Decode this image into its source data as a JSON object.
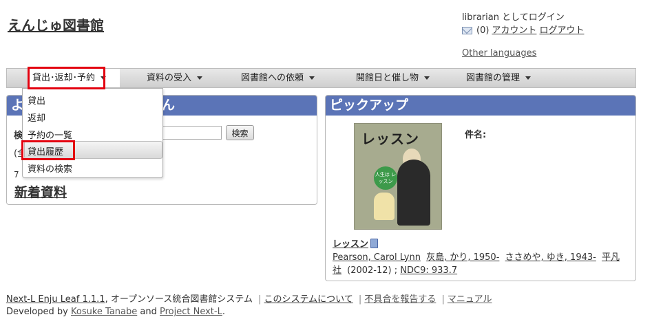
{
  "header": {
    "site_title": "えんじゅ図書館",
    "login_status": "librarian としてログイン",
    "message_count": "(0)",
    "account_link": "アカウント",
    "logout_link": "ログアウト",
    "other_languages": "Other languages"
  },
  "menu": {
    "items": [
      {
        "label": "貸出･返却･予約"
      },
      {
        "label": "資料の受入"
      },
      {
        "label": "図書館への依頼"
      },
      {
        "label": "開館日と催し物"
      },
      {
        "label": "図書館の管理"
      }
    ],
    "dropdown": [
      "貸出",
      "返却",
      "予約の一覧",
      "貸出履歴",
      "資料の検索"
    ],
    "highlight_color": "#e3000f"
  },
  "left_panel": {
    "heading_start": "よ",
    "heading_end": "ん",
    "search_label": "検",
    "search_button": "検索",
    "scope_text": "(全",
    "count_text": "7",
    "new_arrivals": "新着資料"
  },
  "right_panel": {
    "heading": "ピックアップ",
    "subject_label": "件名:",
    "cover_title": "レッスン",
    "cover_badge": "人生は レッスン",
    "book_title": "レッスン",
    "authors": [
      "Pearson, Carol Lynn",
      "灰島, かり, 1950-",
      "ささめや, ゆき, 1943-"
    ],
    "publisher": "平凡社",
    "pub_date": "(2002-12) ;",
    "ndc": "NDC9: 933.7"
  },
  "footer": {
    "product": "Next-L Enju Leaf 1.1.1",
    "description": ", オープンソース統合図書館システム",
    "about": "このシステムについて",
    "report": "不具合を報告する",
    "manual": "マニュアル",
    "developed_by": "Developed by",
    "developer": "Kosuke Tanabe",
    "and": "and",
    "project": "Project Next-L",
    "period": "."
  },
  "colors": {
    "panel_header": "#5b74b7",
    "menubar": "#d8d8d8"
  }
}
